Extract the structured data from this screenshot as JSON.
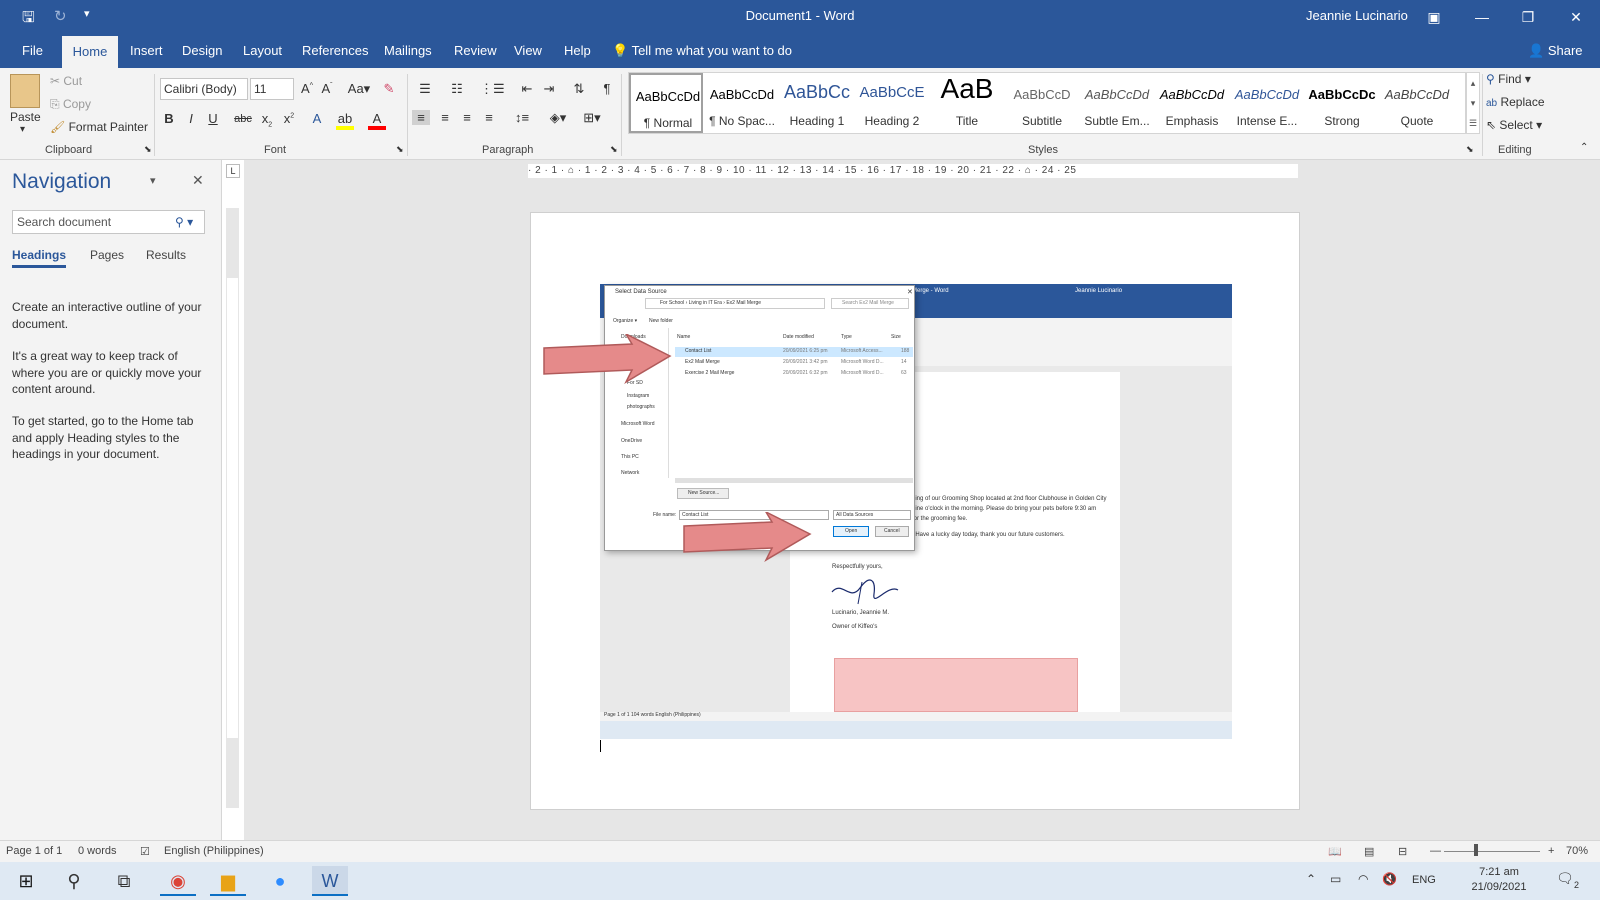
{
  "titlebar": {
    "doc_title": "Document1 - Word",
    "user": "Jeannie Lucinario"
  },
  "menu": {
    "tabs": [
      "File",
      "Home",
      "Insert",
      "Design",
      "Layout",
      "References",
      "Mailings",
      "Review",
      "View",
      "Help"
    ],
    "tellme": "Tell me what you want to do",
    "share": "Share"
  },
  "ribbon": {
    "clipboard": {
      "paste": "Paste",
      "cut": "Cut",
      "copy": "Copy",
      "format_painter": "Format Painter",
      "label": "Clipboard"
    },
    "font": {
      "name": "Calibri (Body)",
      "size": "11",
      "label": "Font"
    },
    "paragraph": {
      "label": "Paragraph"
    },
    "styles": {
      "label": "Styles",
      "items": [
        {
          "sample": "AaBbCcDd",
          "name": "¶ Normal"
        },
        {
          "sample": "AaBbCcDd",
          "name": "¶ No Spac..."
        },
        {
          "sample": "AaBbCc",
          "name": "Heading 1"
        },
        {
          "sample": "AaBbCcE",
          "name": "Heading 2"
        },
        {
          "sample": "AaB",
          "name": "Title"
        },
        {
          "sample": "AaBbCcD",
          "name": "Subtitle"
        },
        {
          "sample": "AaBbCcDd",
          "name": "Subtle Em..."
        },
        {
          "sample": "AaBbCcDd",
          "name": "Emphasis"
        },
        {
          "sample": "AaBbCcDd",
          "name": "Intense E..."
        },
        {
          "sample": "AaBbCcDc",
          "name": "Strong"
        },
        {
          "sample": "AaBbCcDd",
          "name": "Quote"
        }
      ]
    },
    "editing": {
      "find": "Find",
      "replace": "Replace",
      "select": "Select",
      "label": "Editing"
    }
  },
  "nav": {
    "title": "Navigation",
    "search_placeholder": "Search document",
    "tabs": [
      "Headings",
      "Pages",
      "Results"
    ],
    "para1": "Create an interactive outline of your document.",
    "para2": "It's a great way to keep track of where you are or quickly move your content around.",
    "para3": "To get started, go to the Home tab and apply Heading styles to the headings in your document."
  },
  "embedded": {
    "dialog_title": "Select Data Source",
    "path": "For School › Living in IT Era › Ex2 Mail Merge",
    "search": "Search Ex2 Mail Merge",
    "organize": "Organize ▾",
    "new_folder": "New folder",
    "columns": [
      "Name",
      "Date modified",
      "Type",
      "Size"
    ],
    "files": [
      {
        "name": "Contact List",
        "date": "20/09/2021 6:25 pm",
        "type": "Microsoft Access...",
        "size": "188"
      },
      {
        "name": "Ex2 Mail Merge",
        "date": "20/09/2021 3:42 pm",
        "type": "Microsoft Word D...",
        "size": "14"
      },
      {
        "name": "Exercise 2 Mail Merge",
        "date": "20/09/2021 6:32 pm",
        "type": "Microsoft Word D...",
        "size": "63"
      }
    ],
    "sidebar": [
      "Downloads",
      "For SD",
      "Instagram",
      "photographs",
      "Microsoft Word",
      "OneDrive",
      "This PC",
      "Network"
    ],
    "new_source": "New Source...",
    "file_name_label": "File name:",
    "file_name": "Contact List",
    "filter": "All Data Sources",
    "open": "Open",
    "cancel": "Cancel",
    "bg_title": "Merge - Word",
    "bg_user": "Jeannie Lucinario",
    "letter_line1": "ning of our Grooming Shop located at 2nd floor Clubhouse in Golden City",
    "letter_line2": "nine o'clock in the morning. Please do bring your pets before 9:30 am",
    "letter_line3": "for the grooming fee.",
    "letter_line4": ". Have a lucky day today, thank you our future customers.",
    "closing": "Respectfully yours,",
    "signer": "Lucinario, Jeannie M.",
    "owner": "Owner of Kiffeo's",
    "status": "Page 1 of 1   104 words   English (Philippines)"
  },
  "status": {
    "page": "Page 1 of 1",
    "words": "0 words",
    "language": "English (Philippines)",
    "zoom": "70%"
  },
  "taskbar": {
    "time": "7:21 am",
    "date": "21/09/2021",
    "lang": "ENG",
    "notif_count": "2"
  },
  "colors": {
    "word_blue": "#2b579a",
    "arrow": "#e58a8a"
  }
}
